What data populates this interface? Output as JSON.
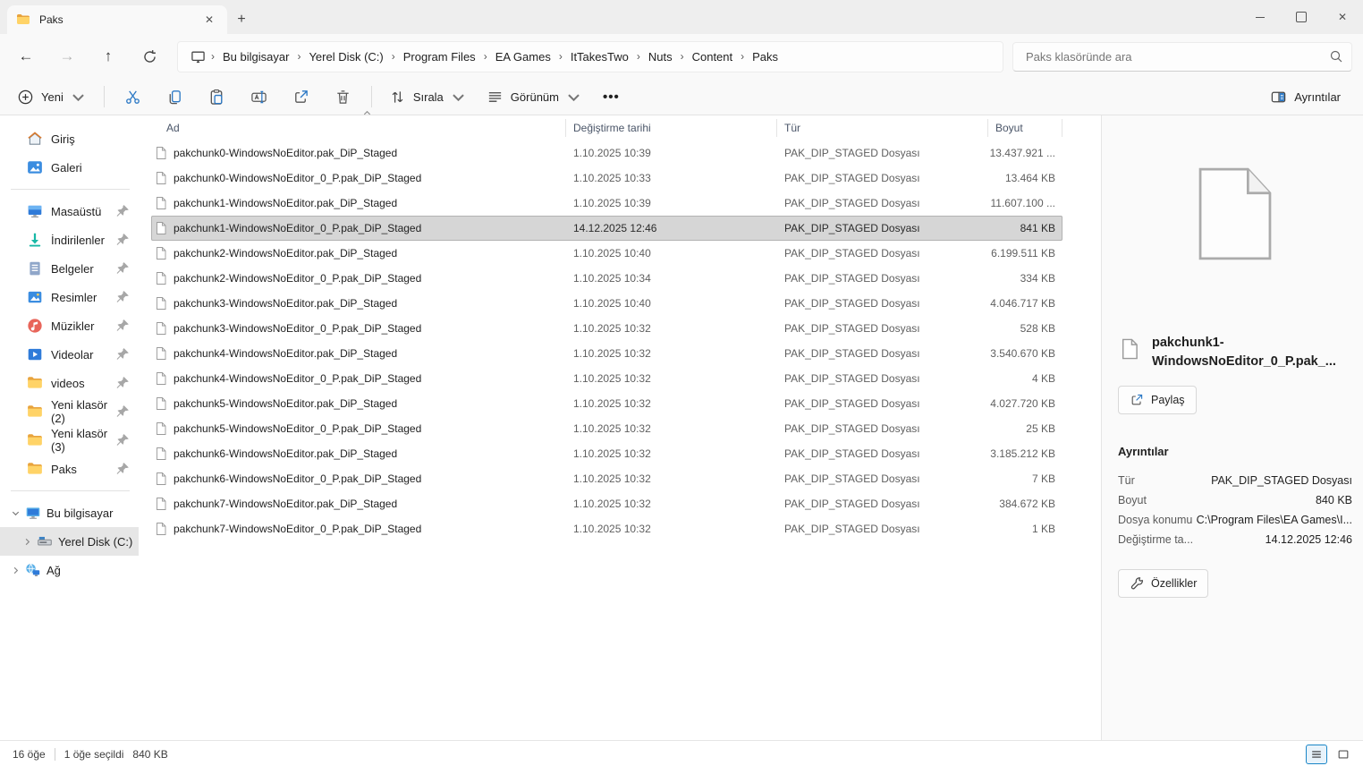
{
  "window": {
    "tab_title": "Paks"
  },
  "breadcrumb": {
    "items": [
      "Bu bilgisayar",
      "Yerel Disk (C:)",
      "Program Files",
      "EA Games",
      "ItTakesTwo",
      "Nuts",
      "Content",
      "Paks"
    ]
  },
  "search": {
    "placeholder": "Paks klasöründe ara"
  },
  "toolbar": {
    "new_label": "Yeni",
    "sort_label": "Sırala",
    "view_label": "Görünüm",
    "details_toggle_label": "Ayrıntılar"
  },
  "sidebar": {
    "quick": [
      {
        "label": "Giriş",
        "icon": "home-icon"
      },
      {
        "label": "Galeri",
        "icon": "gallery-icon"
      }
    ],
    "pinned": [
      {
        "label": "Masaüstü",
        "icon": "desktop-icon"
      },
      {
        "label": "İndirilenler",
        "icon": "downloads-icon"
      },
      {
        "label": "Belgeler",
        "icon": "documents-icon"
      },
      {
        "label": "Resimler",
        "icon": "pictures-icon"
      },
      {
        "label": "Müzikler",
        "icon": "music-icon"
      },
      {
        "label": "Videolar",
        "icon": "videos-icon"
      },
      {
        "label": "videos",
        "icon": "folder-icon"
      },
      {
        "label": "Yeni klasör (2)",
        "icon": "folder-icon"
      },
      {
        "label": "Yeni klasör (3)",
        "icon": "folder-icon"
      },
      {
        "label": "Paks",
        "icon": "folder-icon"
      }
    ],
    "tree": [
      {
        "label": "Bu bilgisayar",
        "icon": "pc-icon",
        "chevron": "down",
        "level": 0,
        "selected": false
      },
      {
        "label": "Yerel Disk (C:)",
        "icon": "drive-icon",
        "chevron": "right",
        "level": 1,
        "selected": true
      },
      {
        "label": "Ağ",
        "icon": "network-icon",
        "chevron": "right",
        "level": 0,
        "selected": false
      }
    ]
  },
  "file_list": {
    "columns": [
      "Ad",
      "Değiştirme tarihi",
      "Tür",
      "Boyut"
    ],
    "rows": [
      {
        "name": "pakchunk0-WindowsNoEditor.pak_DiP_Staged",
        "date": "1.10.2025 10:39",
        "type": "PAK_DIP_STAGED Dosyası",
        "size": "13.437.921 ...",
        "selected": false
      },
      {
        "name": "pakchunk0-WindowsNoEditor_0_P.pak_DiP_Staged",
        "date": "1.10.2025 10:33",
        "type": "PAK_DIP_STAGED Dosyası",
        "size": "13.464 KB",
        "selected": false
      },
      {
        "name": "pakchunk1-WindowsNoEditor.pak_DiP_Staged",
        "date": "1.10.2025 10:39",
        "type": "PAK_DIP_STAGED Dosyası",
        "size": "11.607.100 ...",
        "selected": false
      },
      {
        "name": "pakchunk1-WindowsNoEditor_0_P.pak_DiP_Staged",
        "date": "14.12.2025 12:46",
        "type": "PAK_DIP_STAGED Dosyası",
        "size": "841 KB",
        "selected": true
      },
      {
        "name": "pakchunk2-WindowsNoEditor.pak_DiP_Staged",
        "date": "1.10.2025 10:40",
        "type": "PAK_DIP_STAGED Dosyası",
        "size": "6.199.511 KB",
        "selected": false
      },
      {
        "name": "pakchunk2-WindowsNoEditor_0_P.pak_DiP_Staged",
        "date": "1.10.2025 10:34",
        "type": "PAK_DIP_STAGED Dosyası",
        "size": "334 KB",
        "selected": false
      },
      {
        "name": "pakchunk3-WindowsNoEditor.pak_DiP_Staged",
        "date": "1.10.2025 10:40",
        "type": "PAK_DIP_STAGED Dosyası",
        "size": "4.046.717 KB",
        "selected": false
      },
      {
        "name": "pakchunk3-WindowsNoEditor_0_P.pak_DiP_Staged",
        "date": "1.10.2025 10:32",
        "type": "PAK_DIP_STAGED Dosyası",
        "size": "528 KB",
        "selected": false
      },
      {
        "name": "pakchunk4-WindowsNoEditor.pak_DiP_Staged",
        "date": "1.10.2025 10:32",
        "type": "PAK_DIP_STAGED Dosyası",
        "size": "3.540.670 KB",
        "selected": false
      },
      {
        "name": "pakchunk4-WindowsNoEditor_0_P.pak_DiP_Staged",
        "date": "1.10.2025 10:32",
        "type": "PAK_DIP_STAGED Dosyası",
        "size": "4 KB",
        "selected": false
      },
      {
        "name": "pakchunk5-WindowsNoEditor.pak_DiP_Staged",
        "date": "1.10.2025 10:32",
        "type": "PAK_DIP_STAGED Dosyası",
        "size": "4.027.720 KB",
        "selected": false
      },
      {
        "name": "pakchunk5-WindowsNoEditor_0_P.pak_DiP_Staged",
        "date": "1.10.2025 10:32",
        "type": "PAK_DIP_STAGED Dosyası",
        "size": "25 KB",
        "selected": false
      },
      {
        "name": "pakchunk6-WindowsNoEditor.pak_DiP_Staged",
        "date": "1.10.2025 10:32",
        "type": "PAK_DIP_STAGED Dosyası",
        "size": "3.185.212 KB",
        "selected": false
      },
      {
        "name": "pakchunk6-WindowsNoEditor_0_P.pak_DiP_Staged",
        "date": "1.10.2025 10:32",
        "type": "PAK_DIP_STAGED Dosyası",
        "size": "7 KB",
        "selected": false
      },
      {
        "name": "pakchunk7-WindowsNoEditor.pak_DiP_Staged",
        "date": "1.10.2025 10:32",
        "type": "PAK_DIP_STAGED Dosyası",
        "size": "384.672 KB",
        "selected": false
      },
      {
        "name": "pakchunk7-WindowsNoEditor_0_P.pak_DiP_Staged",
        "date": "1.10.2025 10:32",
        "type": "PAK_DIP_STAGED Dosyası",
        "size": "1 KB",
        "selected": false
      }
    ]
  },
  "details_pane": {
    "file_name": "pakchunk1-WindowsNoEditor_0_P.pak_...",
    "share_label": "Paylaş",
    "section_title": "Ayrıntılar",
    "properties": [
      {
        "label": "Tür",
        "value": "PAK_DIP_STAGED Dosyası"
      },
      {
        "label": "Boyut",
        "value": "840 KB"
      },
      {
        "label": "Dosya konumu",
        "value": "C:\\Program Files\\EA Games\\I..."
      },
      {
        "label": "Değiştirme ta...",
        "value": "14.12.2025 12:46"
      }
    ],
    "properties_label": "Özellikler"
  },
  "status_bar": {
    "items_count": "16 öğe",
    "selection_text": "1 öğe seçildi",
    "selection_size": "840 KB"
  },
  "colors": {
    "accent_blue": "#2b78c5",
    "selection_bg": "#d6d6d6",
    "folder_yellow": "#ffd367"
  }
}
